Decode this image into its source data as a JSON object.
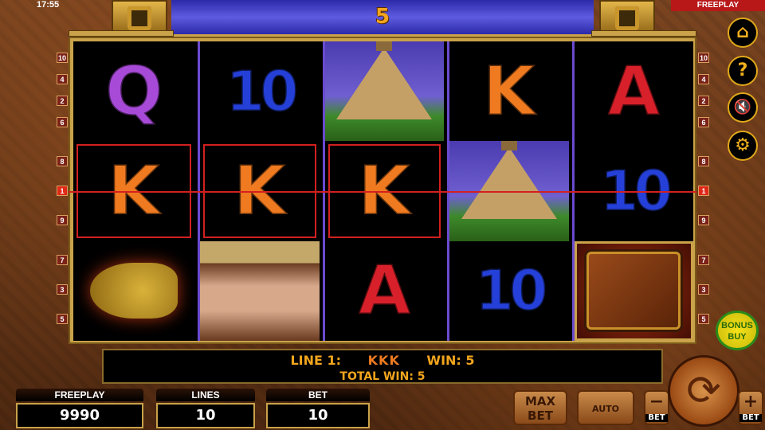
{
  "status": {
    "time": "17:55",
    "mode": "FREEPLAY"
  },
  "header": {
    "win_number": "5"
  },
  "reels": [
    [
      {
        "sym": "Q",
        "color": "purple"
      },
      {
        "sym": "K",
        "color": "orange",
        "win": true
      },
      {
        "sym": "fish",
        "color": "gold"
      }
    ],
    [
      {
        "sym": "10",
        "color": "blue"
      },
      {
        "sym": "K",
        "color": "orange",
        "win": true
      },
      {
        "sym": "explorer",
        "color": "skin"
      }
    ],
    [
      {
        "sym": "pyramid",
        "color": "sand"
      },
      {
        "sym": "K",
        "color": "orange",
        "win": true
      },
      {
        "sym": "A",
        "color": "red"
      }
    ],
    [
      {
        "sym": "K",
        "color": "orange"
      },
      {
        "sym": "pyramid",
        "color": "sand"
      },
      {
        "sym": "10",
        "color": "blue"
      }
    ],
    [
      {
        "sym": "A",
        "color": "red"
      },
      {
        "sym": "10",
        "color": "blue"
      },
      {
        "sym": "book",
        "color": "brown"
      }
    ]
  ],
  "line_numbers": {
    "left": [
      "10",
      "4",
      "2",
      "6",
      "8",
      "1",
      "9",
      "7",
      "3",
      "5"
    ],
    "right": [
      "10",
      "4",
      "2",
      "6",
      "8",
      "1",
      "9",
      "7",
      "3",
      "5"
    ],
    "highlighted": "1"
  },
  "win_info": {
    "line_label": "LINE 1:",
    "symbols": "KKK",
    "win_label": "WIN: 5",
    "total_win": "TOTAL WIN: 5"
  },
  "counters": {
    "freeplay": {
      "label": "FREEPLAY",
      "value": "9990"
    },
    "lines": {
      "label": "LINES",
      "value": "10"
    },
    "bet": {
      "label": "BET",
      "value": "10"
    }
  },
  "buttons": {
    "max_bet": "MAX BET",
    "auto": "AUTO",
    "bet_minus_label": "BET",
    "bet_plus_label": "BET",
    "bonus_buy": "BONUS BUY"
  },
  "icons": {
    "home": "home-icon",
    "help": "help-icon",
    "sound": "sound-muted-icon",
    "settings": "gear-icon",
    "spin": "spin-icon"
  },
  "colors": {
    "accent": "#f2a51d",
    "payline": "#d22020",
    "frame": "#c9a24a"
  }
}
